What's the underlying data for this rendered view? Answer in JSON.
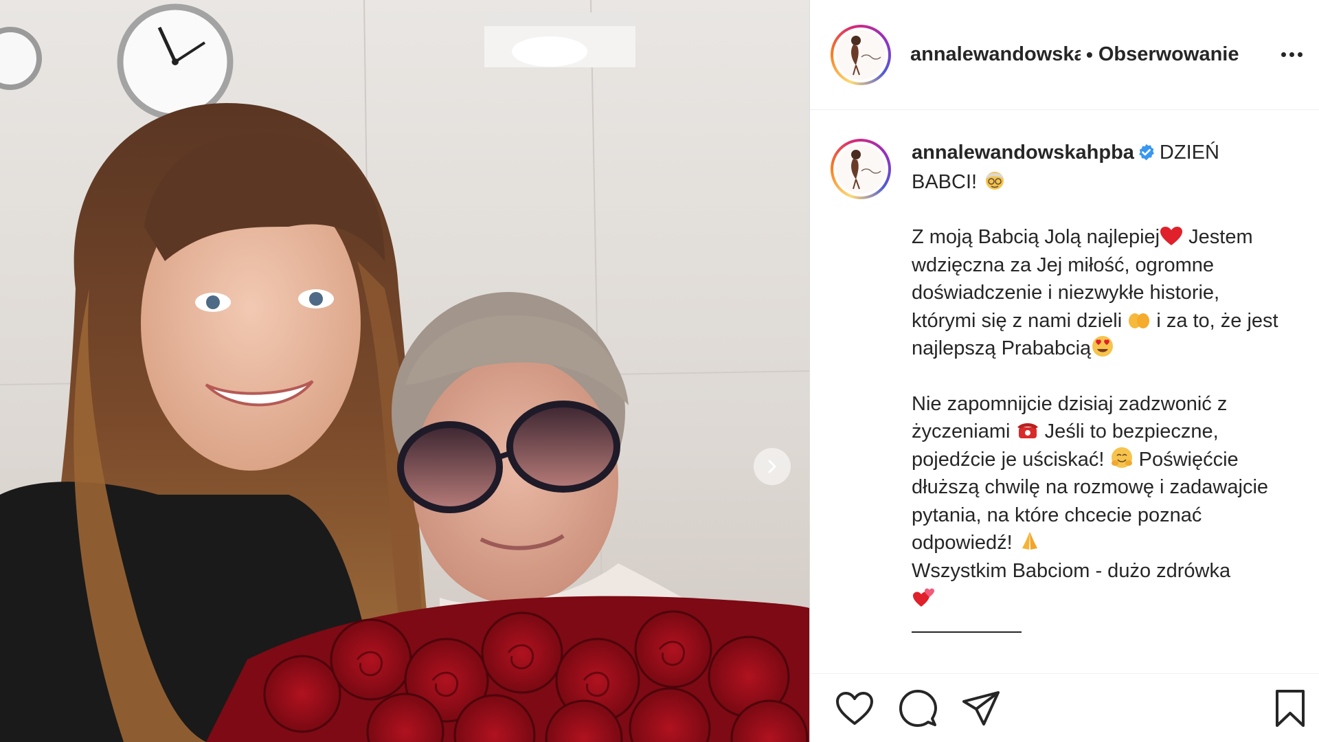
{
  "post": {
    "photo_alt": "Selfie of a young woman with a smiling grandmother with roses"
  },
  "header": {
    "username": "annalewandowskahpba",
    "separator": "•",
    "follow_label": "Obserwowanie",
    "more_icon": "more-horizontal-icon"
  },
  "caption": {
    "username": "annalewandowskahpba",
    "verified_icon": "verified-badge-icon",
    "line_title": "DZIEŃ BABCI!",
    "p1": [
      "Z moją Babcią Jolą najlepiej",
      "Jestem wdzięczna za Jej miłość, ogromne doświadczenie i niezwykłe historie, którymi się z nami dzieli",
      "i za to, że jest najlepszą Prababcią"
    ],
    "p2": [
      "Nie zapomnijcie dzisiaj zadzwonić z życzeniami",
      "Jeśli to bezpieczne, pojedźcie je uściskać!",
      "Poświęćcie dłuższą chwilę na rozmowę i zadawajcie pytania, na które chcecie poznać odpowiedź!",
      "Wszystkim Babciom - dużo zdrówka"
    ]
  },
  "actions": {
    "like_icon": "heart-icon",
    "comment_icon": "comment-icon",
    "share_icon": "send-icon",
    "save_icon": "bookmark-icon"
  },
  "colors": {
    "text": "#262626",
    "verified": "#3897f0",
    "border": "#dbdbdb"
  }
}
